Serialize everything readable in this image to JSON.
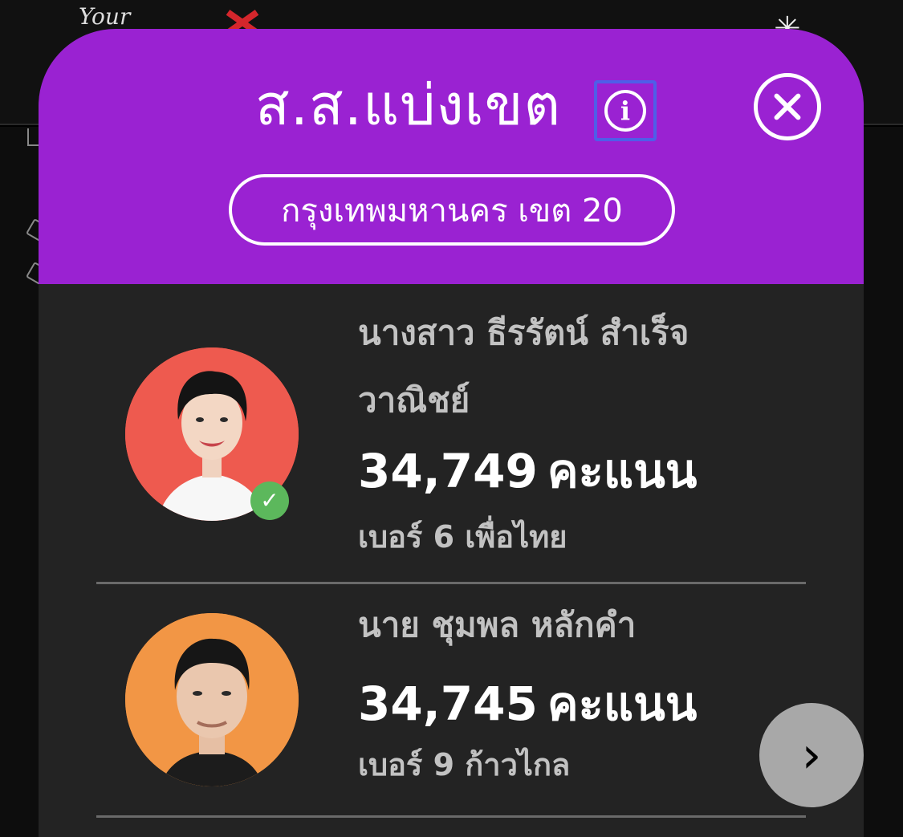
{
  "background": {
    "logo_text": "Your"
  },
  "modal": {
    "title": "ส.ส.แบ่งเขต",
    "district": "กรุงเทพมหานคร เขต 20",
    "info_icon": "info-icon",
    "close_icon": "close-icon"
  },
  "candidates": [
    {
      "name_line1": "นางสาว ธีรรัตน์ สำเร็จ",
      "name_line2": "วาณิชย์",
      "votes": "34,749",
      "votes_unit": "คะแนน",
      "party_line": "เบอร์ 6 เพื่อไทย",
      "avatar_color": "#ee5a4f",
      "winner": true,
      "badge_icon": "check-icon"
    },
    {
      "name_line1": "นาย ชุมพล หลักคำ",
      "votes": "34,745",
      "votes_unit": "คะแนน",
      "party_line": "เบอร์ 9 ก้าวไกล",
      "avatar_color": "#f29645",
      "winner": false
    }
  ],
  "next_icon": "chevron-right-icon",
  "colors": {
    "header_purple": "#9a22d2",
    "panel_bg": "#232323",
    "info_focus": "#4f5ee8",
    "winner_badge": "#5cb85c",
    "next_button": "#a8a8a8"
  }
}
